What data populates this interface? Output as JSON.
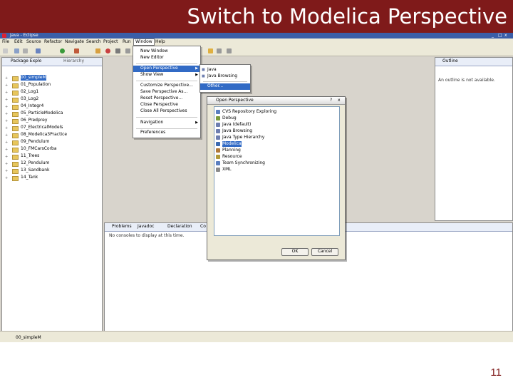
{
  "slide": {
    "title": "Switch to Modelica Perspective",
    "page_number": "11"
  },
  "window": {
    "title": "Java - Eclipse",
    "controls": [
      "_",
      "□",
      "x"
    ]
  },
  "menubar": [
    "File",
    "Edit",
    "Source",
    "Refactor",
    "Navigate",
    "Search",
    "Project",
    "Run",
    "Window",
    "Help"
  ],
  "package_explorer": {
    "tabs": [
      "Package Explo",
      "Hierarchy"
    ],
    "items": [
      {
        "label": "00_simpleM",
        "selected": true
      },
      {
        "label": "01_Population",
        "selected": false
      },
      {
        "label": "02_Log1",
        "selected": false
      },
      {
        "label": "03_Log2",
        "selected": false
      },
      {
        "label": "04_Integr4",
        "selected": false
      },
      {
        "label": "05_ParticleModelica",
        "selected": false
      },
      {
        "label": "06_Predprey",
        "selected": false
      },
      {
        "label": "07_ElectricalModels",
        "selected": false
      },
      {
        "label": "08_Modelica3Practice",
        "selected": false
      },
      {
        "label": "09_Pendulum",
        "selected": false
      },
      {
        "label": "10_FMCarsCorba",
        "selected": false
      },
      {
        "label": "11_Trees",
        "selected": false
      },
      {
        "label": "12_Pendulum",
        "selected": false
      },
      {
        "label": "13_Sandbank",
        "selected": false
      },
      {
        "label": "14_Tank",
        "selected": false
      }
    ]
  },
  "window_menu": {
    "items": [
      {
        "label": "New Window",
        "arrow": false
      },
      {
        "label": "New Editor",
        "arrow": false
      },
      {
        "label": "Open Perspective",
        "arrow": true,
        "highlighted": true
      },
      {
        "label": "Show View",
        "arrow": true
      },
      {
        "label": "Customize Perspective...",
        "arrow": false
      },
      {
        "label": "Save Perspective As...",
        "arrow": false
      },
      {
        "label": "Reset Perspective...",
        "arrow": false
      },
      {
        "label": "Close Perspective",
        "arrow": false
      },
      {
        "label": "Close All Perspectives",
        "arrow": false
      },
      {
        "label": "Navigation",
        "arrow": true
      },
      {
        "label": "Preferences",
        "arrow": false
      }
    ]
  },
  "perspective_submenu": {
    "items": [
      {
        "label": "Java"
      },
      {
        "label": "Java Browsing"
      },
      {
        "label": "Other...",
        "highlighted": true
      }
    ]
  },
  "outline": {
    "tab": "Outline",
    "message": "An outline is not available."
  },
  "bottom_panel": {
    "tabs": [
      "Problems",
      "Javadoc",
      "Declaration",
      "Co"
    ],
    "message": "No consoles to display at this time."
  },
  "dialog": {
    "title": "Open Perspective",
    "items": [
      {
        "label": "CVS Repository Exploring",
        "icon_color": "#5a7fbf"
      },
      {
        "label": "Debug",
        "icon_color": "#7a9a3a"
      },
      {
        "label": "Java (default)",
        "icon_color": "#6e7fb0"
      },
      {
        "label": "Java Browsing",
        "icon_color": "#6e7fb0"
      },
      {
        "label": "Java Type Hierarchy",
        "icon_color": "#6e7fb0"
      },
      {
        "label": "Modelica",
        "icon_color": "#3b6ab0",
        "selected": true
      },
      {
        "label": "Planning",
        "icon_color": "#b07a3a"
      },
      {
        "label": "Resource",
        "icon_color": "#b09a3a"
      },
      {
        "label": "Team Synchronizing",
        "icon_color": "#5a7fbf"
      },
      {
        "label": "XML",
        "icon_color": "#8a8a8a"
      }
    ],
    "ok_label": "OK",
    "cancel_label": "Cancel"
  },
  "status": {
    "text": "00_simpleM"
  },
  "colors": {
    "title_bar": "#7f1a1a",
    "selection": "#316ac5",
    "menu_bg": "#ece9d8"
  }
}
